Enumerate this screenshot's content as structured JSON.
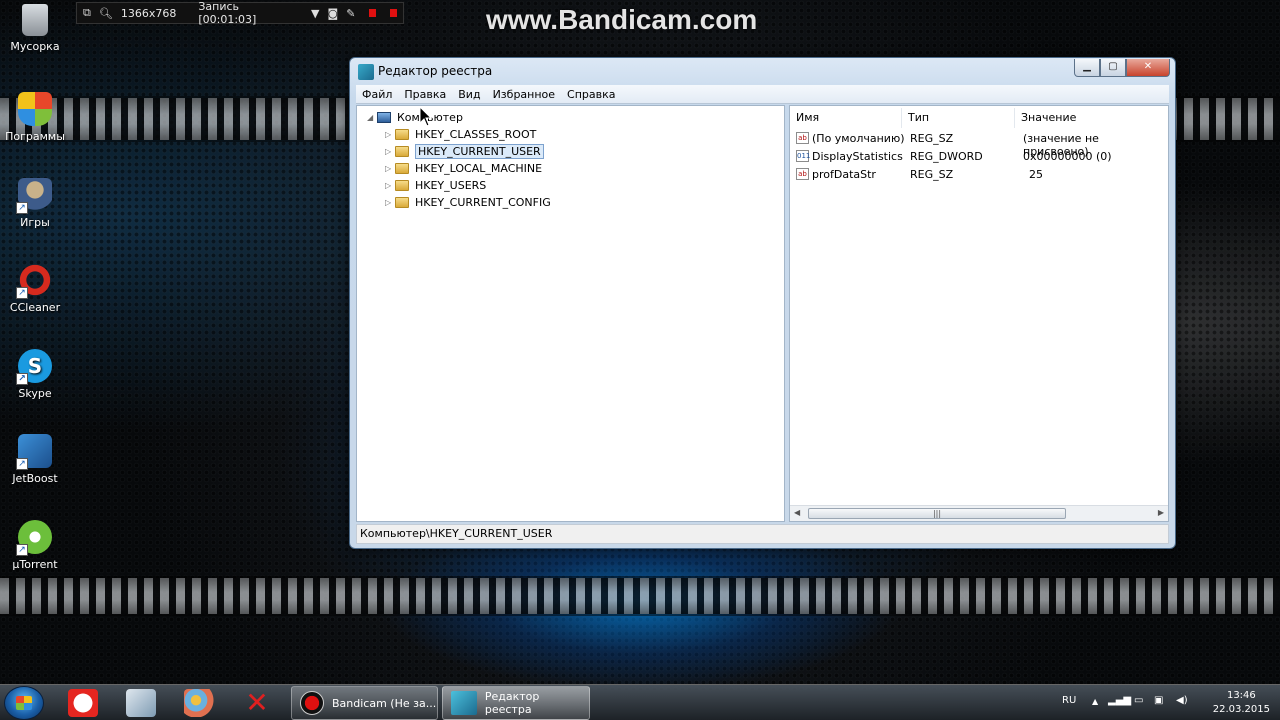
{
  "recorder": {
    "resolution": "1366x768",
    "recording": "Запись [00:01:03]"
  },
  "watermark": "www.Bandicam.com",
  "desktop_icons": [
    {
      "label": "Мусорка",
      "icon": "recycle-bin-icon"
    },
    {
      "label": "Пограммы",
      "icon": "windows-shield-icon"
    },
    {
      "label": "Игры",
      "icon": "games-icon"
    },
    {
      "label": "CCleaner",
      "icon": "ccleaner-icon"
    },
    {
      "label": "Skype",
      "icon": "skype-icon"
    },
    {
      "label": "JetBoost",
      "icon": "jetboost-icon"
    },
    {
      "label": "µTorrent",
      "icon": "utorrent-icon"
    }
  ],
  "window": {
    "title": "Редактор реестра",
    "menu": [
      "Файл",
      "Правка",
      "Вид",
      "Избранное",
      "Справка"
    ],
    "tree": {
      "root": "Компьютер",
      "keys": [
        "HKEY_CLASSES_ROOT",
        "HKEY_CURRENT_USER",
        "HKEY_LOCAL_MACHINE",
        "HKEY_USERS",
        "HKEY_CURRENT_CONFIG"
      ],
      "selected": "HKEY_CURRENT_USER"
    },
    "columns": [
      "Имя",
      "Тип",
      "Значение"
    ],
    "values": [
      {
        "name": "(По умолчанию)",
        "type": "REG_SZ",
        "data": "(значение не присвоено)",
        "icon": "ab"
      },
      {
        "name": "DisplayStatistics",
        "type": "REG_DWORD",
        "data": "0x00000000 (0)",
        "icon": "011"
      },
      {
        "name": "profDataStr",
        "type": "REG_SZ",
        "data": "25",
        "icon": "ab"
      }
    ],
    "status": "Компьютер\\HKEY_CURRENT_USER"
  },
  "taskbar": {
    "tasks": [
      {
        "label": "Bandicam (Не за...",
        "icon": "bandicam-icon"
      },
      {
        "label": "Редактор реестра",
        "icon": "regedit-icon"
      }
    ],
    "language": "RU",
    "time": "13:46",
    "date": "22.03.2015"
  },
  "colors": {
    "selection": "#dbeaf9",
    "title_gradient": "#dce8f5",
    "close_button": "#c8432c"
  }
}
